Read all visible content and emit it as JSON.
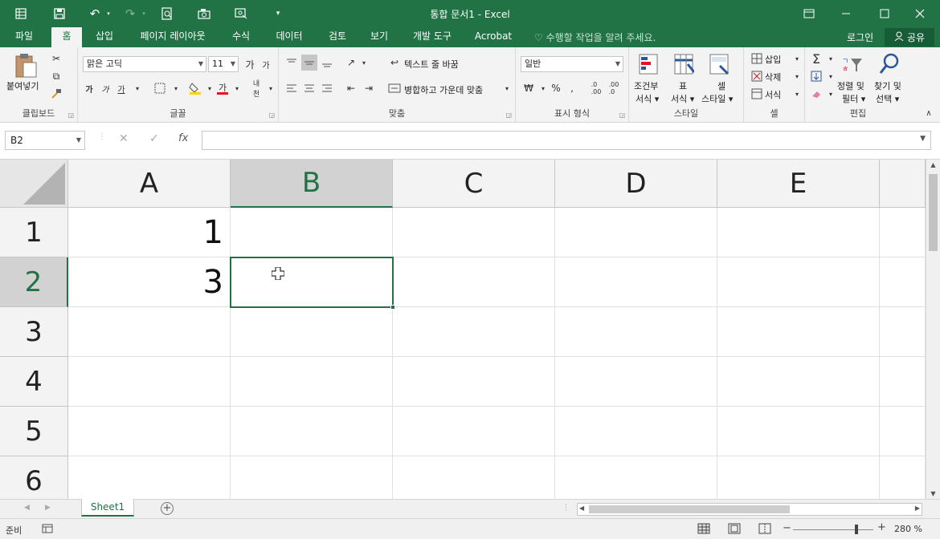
{
  "window": {
    "title": "통합 문서1 - Excel",
    "brand_color": "#217346"
  },
  "quick_access": [
    "save-icon",
    "undo-icon",
    "redo-icon",
    "print-preview-icon",
    "camera-icon",
    "screenshot-icon",
    "customize-icon"
  ],
  "tabs": [
    {
      "label": "파일",
      "active": false
    },
    {
      "label": "홈",
      "active": true
    },
    {
      "label": "삽입",
      "active": false
    },
    {
      "label": "페이지 레이아웃",
      "active": false
    },
    {
      "label": "수식",
      "active": false
    },
    {
      "label": "데이터",
      "active": false
    },
    {
      "label": "검토",
      "active": false
    },
    {
      "label": "보기",
      "active": false
    },
    {
      "label": "개발 도구",
      "active": false
    },
    {
      "label": "Acrobat",
      "active": false
    }
  ],
  "tell_me": "수행할 작업을 알려 주세요.",
  "login": "로그인",
  "share": "공유",
  "ribbon": {
    "clipboard": {
      "paste": "붙여넣기",
      "label": "클립보드"
    },
    "font": {
      "name": "맑은 고딕",
      "size": "11",
      "label": "글꼴"
    },
    "alignment": {
      "wrap_text": "텍스트 줄 바꿈",
      "merge_center": "병합하고 가운데 맞춤",
      "label": "맞춤"
    },
    "number": {
      "format": "일반",
      "label": "표시 형식"
    },
    "styles": {
      "conditional": "조건부",
      "conditional2": "서식",
      "table": "표",
      "table2": "서식",
      "cell_styles": "셀",
      "cell_styles2": "스타일",
      "label": "스타일"
    },
    "cells": {
      "insert": "삽입",
      "delete": "삭제",
      "format": "서식",
      "label": "셀"
    },
    "editing": {
      "sort": "정렬 및",
      "sort2": "필터",
      "find": "찾기 및",
      "find2": "선택",
      "label": "편집"
    }
  },
  "formula_bar": {
    "name_box": "B2",
    "formula": ""
  },
  "grid": {
    "columns": [
      "A",
      "B",
      "C",
      "D",
      "E"
    ],
    "selected_column": "B",
    "rows": [
      "1",
      "2",
      "3",
      "4",
      "5",
      "6"
    ],
    "selected_row": "2",
    "cells": {
      "A1": "1",
      "A2": "3"
    },
    "active_cell": "B2"
  },
  "sheets": [
    "Sheet1"
  ],
  "status": {
    "mode": "준비",
    "zoom": "280 %"
  }
}
